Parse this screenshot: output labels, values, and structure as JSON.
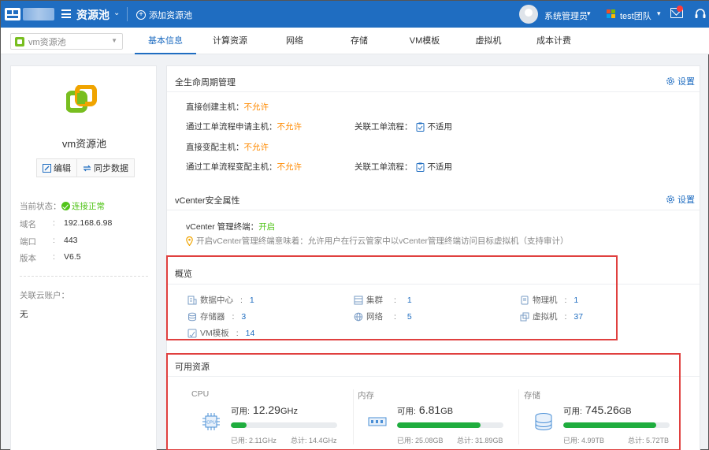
{
  "topbar": {
    "title": "资源池",
    "add_pool": "添加资源池",
    "user": "系统管理员",
    "team": "test团队"
  },
  "pool_select": {
    "value": "vm资源池"
  },
  "tabs": [
    {
      "label": "基本信息",
      "active": true
    },
    {
      "label": "计算资源"
    },
    {
      "label": "网络"
    },
    {
      "label": "存储"
    },
    {
      "label": "VM模板"
    },
    {
      "label": "虚拟机"
    },
    {
      "label": "成本计费"
    }
  ],
  "left": {
    "pool_name": "vm资源池",
    "edit_label": "编辑",
    "sync_label": "同步数据",
    "status_label": "当前状态：",
    "status_value": "连接正常",
    "domain_label": "域名",
    "domain_value": "192.168.6.98",
    "port_label": "端口",
    "port_value": "443",
    "version_label": "版本",
    "version_value": "V6.5",
    "colon": ":",
    "acct_label": "关联云账户：",
    "acct_value": "无"
  },
  "lifecycle": {
    "title": "全生命周期管理",
    "settings": "设置",
    "create_label": "直接创建主机：",
    "create_value": "不允许",
    "apply_label": "通过工单流程申请主机：",
    "apply_value": "不允许",
    "apply_flow_label": "关联工单流程：",
    "apply_flow_value": "不适用",
    "change_label": "直接变配主机：",
    "change_value": "不允许",
    "change_wf_label": "通过工单流程变配主机：",
    "change_wf_value": "不允许",
    "change_flow_label": "关联工单流程：",
    "change_flow_value": "不适用"
  },
  "vcenter": {
    "title": "vCenter安全属性",
    "settings": "设置",
    "terminal_label": "vCenter 管理终端：",
    "terminal_value": "开启",
    "hint": "开启vCenter管理终端意味着：允许用户在行云管家中以vCenter管理终端访问目标虚拟机（支持审计）"
  },
  "overview": {
    "title": "概览",
    "items": [
      {
        "label": "数据中心",
        "value": "1",
        "icon": "datacenter-icon"
      },
      {
        "label": "集群",
        "value": "1",
        "icon": "cluster-icon"
      },
      {
        "label": "物理机",
        "value": "1",
        "icon": "physical-host-icon"
      },
      {
        "label": "存储器",
        "value": "3",
        "icon": "storage-icon"
      },
      {
        "label": "网络",
        "value": "5",
        "icon": "network-icon"
      },
      {
        "label": "虚拟机",
        "value": "37",
        "icon": "vm-icon"
      },
      {
        "label": "VM模板",
        "value": "14",
        "icon": "template-icon"
      }
    ],
    "colon": ":"
  },
  "resources": {
    "title": "可用资源",
    "avail_label": "可用:",
    "used_label": "已用:",
    "total_label": "总计:",
    "cpu": {
      "name": "CPU",
      "icon_text": "CPU",
      "avail": "12.29",
      "unit": "GHz",
      "used": "2.11GHz",
      "total": "14.4GHz",
      "used_ratio": 0.147
    },
    "mem": {
      "name": "内存",
      "avail": "6.81",
      "unit": "GB",
      "used": "25.08GB",
      "total": "31.89GB",
      "used_ratio": 0.786
    },
    "disk": {
      "name": "存储",
      "avail": "745.26",
      "unit": "GB",
      "used": "4.99TB",
      "total": "5.72TB",
      "used_ratio": 0.872
    }
  },
  "colors": {
    "primary": "#1f6dc1",
    "ok": "#52c41a",
    "warn": "#ff8a00",
    "bar": "#1fad3e",
    "highlight": "#e0403f"
  }
}
